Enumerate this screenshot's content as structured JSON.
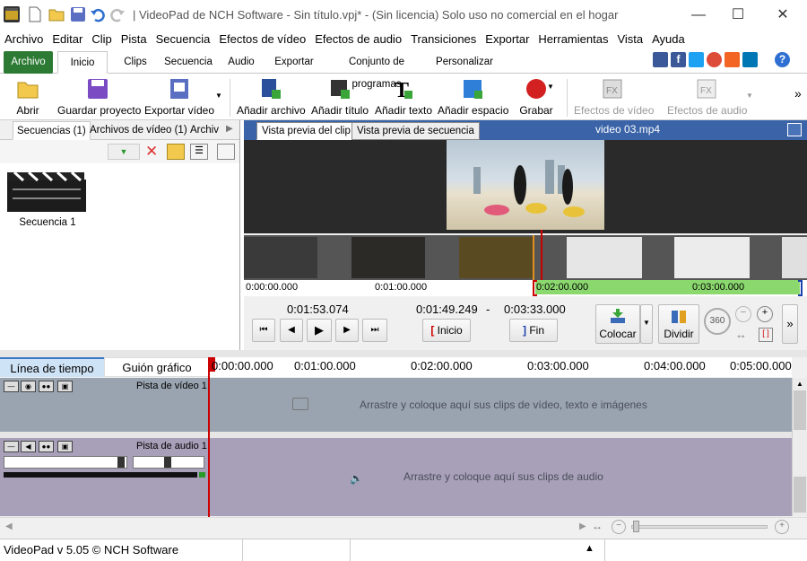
{
  "app": {
    "title": "| VideoPad de NCH Software - Sin título.vpj* - (Sin licencia) Solo uso no comercial en el hogar",
    "status": "VideoPad v 5.05 © NCH Software"
  },
  "menu": [
    "Archivo",
    "Editar",
    "Clip",
    "Pista",
    "Secuencia",
    "Efectos de vídeo",
    "Efectos de audio",
    "Transiciones",
    "Exportar",
    "Herramientas",
    "Vista",
    "Ayuda"
  ],
  "tabs": {
    "archivo": "Archivo",
    "items": [
      "Inicio",
      "Clips",
      "Secuencia",
      "Audio",
      "Exportar",
      "Conjunto de programas",
      "Personalizar"
    ]
  },
  "ribbon": {
    "abrir": "Abrir",
    "guardar": "Guardar proyecto",
    "exportar": "Exportar vídeo",
    "anadir_archivo": "Añadir archivo",
    "anadir_titulo": "Añadir título",
    "anadir_texto": "Añadir texto",
    "anadir_espacio": "Añadir espacio",
    "grabar": "Grabar",
    "efectos_video": "Efectos de vídeo",
    "efectos_audio": "Efectos de audio",
    "more": "»"
  },
  "left_panel": {
    "tabs": [
      "Secuencias (1)",
      "Archivos de vídeo (1)",
      "Archiv"
    ],
    "item_label": "Secuencia 1"
  },
  "preview": {
    "tab_clip": "Vista previa del clip",
    "tab_seq": "Vista previa de secuencia",
    "filename": "video 03.mp4",
    "ruler": [
      "0:00:00.000",
      "0:01:00.000",
      "0:02:00.000",
      "0:03:00.000"
    ],
    "current_time": "0:01:53.074",
    "in_time": "0:01:49.249",
    "dash": "-",
    "out_time": "0:03:33.000",
    "inicio": "Inicio",
    "fin": "Fin",
    "colocar": "Colocar",
    "dividir": "Dividir",
    "rotate": "360"
  },
  "timeline": {
    "tab_timeline": "Línea de tiempo",
    "tab_storyboard": "Guión gráfico",
    "ruler": [
      "0:00:00.000",
      "0:01:00.000",
      "0:02:00.000",
      "0:03:00.000",
      "0:04:00.000",
      "0:05:00.000"
    ],
    "video_track": "Pista de vídeo 1",
    "video_hint": "Arrastre y coloque aquí sus clips de vídeo, texto e imágenes",
    "audio_track": "Pista de audio 1",
    "audio_hint": "Arrastre y coloque aquí sus clips de audio"
  },
  "colors": {
    "accent": "#3a63a8",
    "archivo_tab": "#2d7a34",
    "video_track": "#9aa4b0",
    "audio_track": "#a89fb8",
    "selection": "#7ed36b",
    "playhead": "#cc0000"
  }
}
